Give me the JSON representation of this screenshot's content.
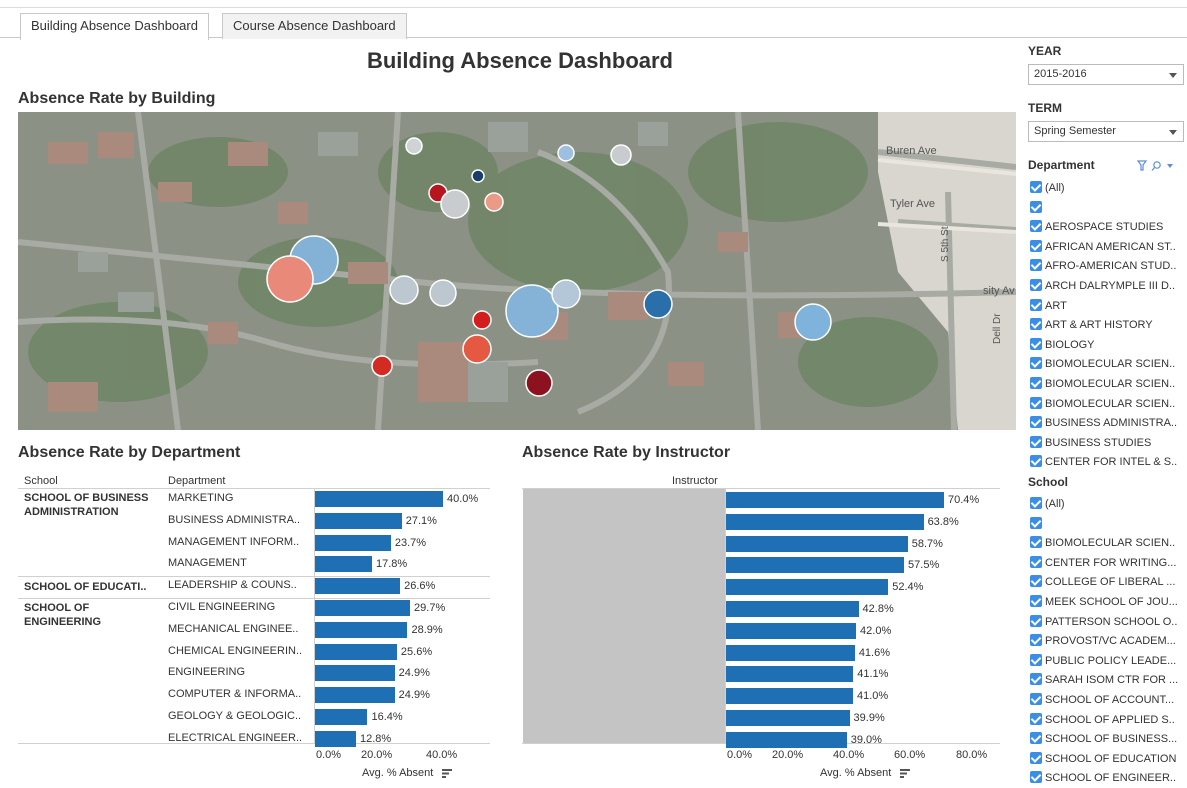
{
  "tabs": [
    {
      "label": "Building Absence Dashboard",
      "active": true
    },
    {
      "label": "Course Absence Dashboard",
      "active": false
    }
  ],
  "dashboard_title": "Building Absence Dashboard",
  "map_section": {
    "title": "Absence Rate by Building",
    "street_labels": [
      "Buren Ave",
      "Tyler Ave",
      "S 5th St",
      "sity Av",
      "Dell Dr"
    ]
  },
  "department_section": {
    "title": "Absence Rate by Department",
    "col_school": "School",
    "col_department": "Department",
    "schools": [
      {
        "name": "SCHOOL OF BUSINESS ADMINISTRATION",
        "lines": [
          "SCHOOL OF BUSINESS",
          "ADMINISTRATION"
        ]
      },
      {
        "name": "SCHOOL OF EDUCATI..",
        "lines": [
          "SCHOOL OF EDUCATI.."
        ]
      },
      {
        "name": "SCHOOL OF ENGINEERING",
        "lines": [
          "SCHOOL OF",
          "ENGINEERING"
        ]
      }
    ],
    "axis_ticks": [
      "0.0%",
      "20.0%",
      "40.0%"
    ],
    "axis_title": "Avg. % Absent"
  },
  "instructor_section": {
    "title": "Absence Rate by Instructor",
    "col_instructor": "Instructor",
    "axis_ticks": [
      "0.0%",
      "20.0%",
      "40.0%",
      "60.0%",
      "80.0%"
    ],
    "axis_title": "Avg. % Absent"
  },
  "chart_data": [
    {
      "type": "bar",
      "title": "Absence Rate by Department",
      "xlabel": "Avg. % Absent",
      "xlim": [
        0,
        45
      ],
      "categories": [
        "MARKETING",
        "BUSINESS ADMINISTRA..",
        "MANAGEMENT INFORM..",
        "MANAGEMENT",
        "LEADERSHIP & COUNS..",
        "CIVIL ENGINEERING",
        "MECHANICAL ENGINEE..",
        "CHEMICAL ENGINEERIN..",
        "ENGINEERING",
        "COMPUTER & INFORMA..",
        "GEOLOGY & GEOLOGIC..",
        "ELECTRICAL ENGINEER.."
      ],
      "values": [
        40.0,
        27.1,
        23.7,
        17.8,
        26.6,
        29.7,
        28.9,
        25.6,
        24.9,
        24.9,
        16.4,
        12.8
      ],
      "labels": [
        "40.0%",
        "27.1%",
        "23.7%",
        "17.8%",
        "26.6%",
        "29.7%",
        "28.9%",
        "25.6%",
        "24.9%",
        "24.9%",
        "16.4%",
        "12.8%"
      ]
    },
    {
      "type": "bar",
      "title": "Absence Rate by Instructor",
      "xlabel": "Avg. % Absent",
      "xlim": [
        0,
        85
      ],
      "values": [
        70.4,
        63.8,
        58.7,
        57.5,
        52.4,
        42.8,
        42.0,
        41.6,
        41.1,
        41.0,
        39.9,
        39.0
      ],
      "labels": [
        "70.4%",
        "63.8%",
        "58.7%",
        "57.5%",
        "52.4%",
        "42.8%",
        "42.0%",
        "41.6%",
        "41.1%",
        "41.0%",
        "39.9%",
        "39.0%"
      ]
    }
  ],
  "filters": {
    "year": {
      "title": "YEAR",
      "value": "2015-2016"
    },
    "term": {
      "title": "TERM",
      "value": "Spring Semester"
    },
    "department": {
      "title": "Department",
      "items": [
        "(All)",
        "",
        "AEROSPACE STUDIES",
        "AFRICAN AMERICAN ST..",
        "AFRO-AMERICAN STUD..",
        "ARCH DALRYMPLE III D..",
        "ART",
        "ART & ART HISTORY",
        "BIOLOGY",
        "BIOMOLECULAR SCIEN..",
        "BIOMOLECULAR SCIEN..",
        "BIOMOLECULAR SCIEN..",
        "BUSINESS ADMINISTRA..",
        "BUSINESS STUDIES",
        "CENTER FOR INTEL & S.."
      ]
    },
    "school": {
      "title": "School",
      "items": [
        "(All)",
        "",
        "BIOMOLECULAR SCIEN..",
        "CENTER FOR WRITING...",
        "COLLEGE OF LIBERAL ...",
        "MEEK SCHOOL OF JOU...",
        "PATTERSON SCHOOL O..",
        "PROVOST/VC ACADEM...",
        "PUBLIC POLICY LEADE...",
        "SARAH ISOM CTR FOR ...",
        "SCHOOL OF ACCOUNT...",
        "SCHOOL OF APPLIED S..",
        "SCHOOL OF BUSINESS...",
        "SCHOOL OF EDUCATION",
        "SCHOOL OF ENGINEER.."
      ]
    }
  },
  "colors": {
    "bar": "#1f6fb4",
    "checkbox": "#3a8ee6",
    "instructor_panel": "#c4c4c4"
  }
}
